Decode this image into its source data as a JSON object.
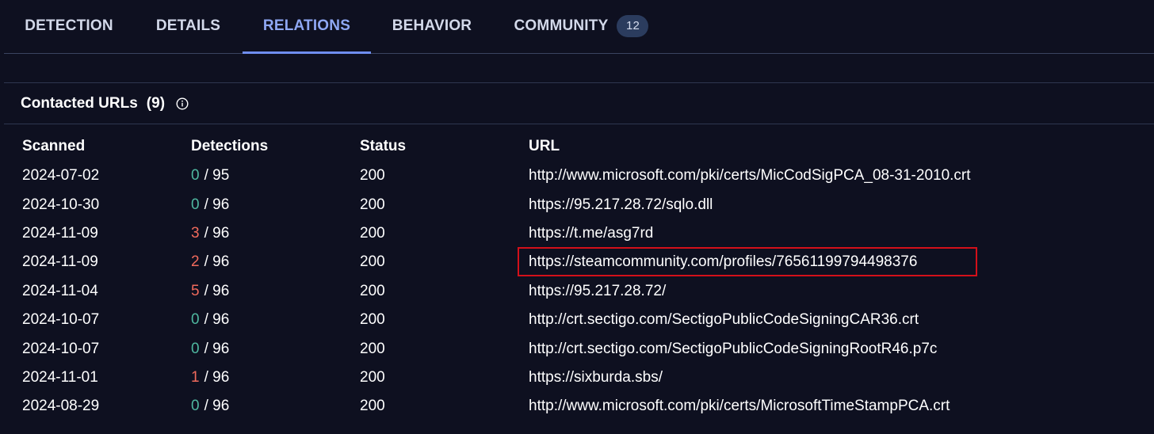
{
  "tabs": [
    {
      "label": "DETECTION",
      "active": false
    },
    {
      "label": "DETAILS",
      "active": false
    },
    {
      "label": "RELATIONS",
      "active": true
    },
    {
      "label": "BEHAVIOR",
      "active": false
    },
    {
      "label": "COMMUNITY",
      "active": false,
      "badge": "12"
    }
  ],
  "section": {
    "title": "Contacted URLs",
    "count": "(9)",
    "icon": "info-icon"
  },
  "table": {
    "headers": [
      "Scanned",
      "Detections",
      "Status",
      "URL"
    ],
    "rows": [
      {
        "scanned": "2024-07-02",
        "detections": "0",
        "total": "/ 95",
        "status": "200",
        "url": "http://www.microsoft.com/pki/certs/MicCodSigPCA_08-31-2010.crt",
        "flagged": false
      },
      {
        "scanned": "2024-10-30",
        "detections": "0",
        "total": "/ 96",
        "status": "200",
        "url": "https://95.217.28.72/sqlo.dll",
        "flagged": false
      },
      {
        "scanned": "2024-11-09",
        "detections": "3",
        "total": "/ 96",
        "status": "200",
        "url": "https://t.me/asg7rd",
        "flagged": true
      },
      {
        "scanned": "2024-11-09",
        "detections": "2",
        "total": "/ 96",
        "status": "200",
        "url": "https://steamcommunity.com/profiles/76561199794498376",
        "flagged": true
      },
      {
        "scanned": "2024-11-04",
        "detections": "5",
        "total": "/ 96",
        "status": "200",
        "url": "https://95.217.28.72/",
        "flagged": true
      },
      {
        "scanned": "2024-10-07",
        "detections": "0",
        "total": "/ 96",
        "status": "200",
        "url": "http://crt.sectigo.com/SectigoPublicCodeSigningCAR36.crt",
        "flagged": false
      },
      {
        "scanned": "2024-10-07",
        "detections": "0",
        "total": "/ 96",
        "status": "200",
        "url": "http://crt.sectigo.com/SectigoPublicCodeSigningRootR46.p7c",
        "flagged": false
      },
      {
        "scanned": "2024-11-01",
        "detections": "1",
        "total": "/ 96",
        "status": "200",
        "url": "https://sixburda.sbs/",
        "flagged": true
      },
      {
        "scanned": "2024-08-29",
        "detections": "0",
        "total": "/ 96",
        "status": "200",
        "url": "http://www.microsoft.com/pki/certs/MicrosoftTimeStampPCA.crt",
        "flagged": false
      }
    ]
  },
  "colors": {
    "background": "#0e1020",
    "active_tab": "#8fa8f4",
    "clean": "#4fb8a0",
    "malicious": "#f06a5c",
    "highlight": "#d3101a"
  }
}
